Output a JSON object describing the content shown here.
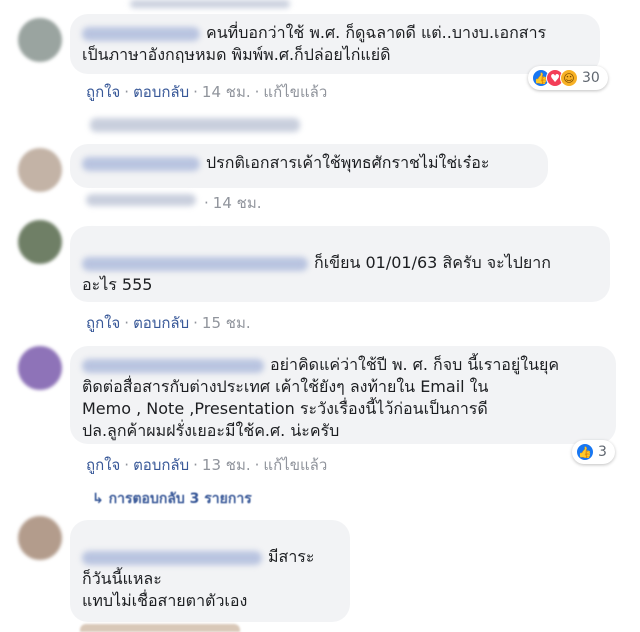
{
  "colors": {
    "link": "#385898",
    "meta": "#90949c",
    "bubble": "#f2f3f5",
    "like": "#1877f2",
    "love": "#f33e58",
    "haha": "#f7b125"
  },
  "comments": [
    {
      "line1": "คนที่บอกว่าใช้ พ.ศ. ก็ดูฉลาดดี แต่..บางบ.เอกสาร",
      "line2": "เป็นภาษาอังกฤษหมด พิมพ์พ.ศ.ก็ปล่อยไก่แย่ดิ",
      "like": "ถูกใจ",
      "reply": "ตอบกลับ",
      "time": "14 ชม.",
      "edited": "แก้ไขแล้ว",
      "reactions": {
        "icons": [
          "like-icon",
          "love-icon",
          "haha-icon"
        ],
        "count": "30"
      }
    },
    {
      "line1": "ปรกติเอกสารเค้าใช้พุทธศักราชไม่ใช่เร๋อะ",
      "time": "14 ชม."
    },
    {
      "line1": "ก็เขียน 01/01/63 สิครับ จะไปยาก",
      "line2": "อะไร 555",
      "like": "ถูกใจ",
      "reply": "ตอบกลับ",
      "time": "15 ชม."
    },
    {
      "line1": "อย่าคิดแค่ว่าใช้ปี พ. ศ. ก็จบ นี้เราอยู่ในยุค",
      "line2": "ติดต่อสื่อสารกับต่างประเทศ เค้าใช้ยังๆ ลงท้ายใน Email ใน",
      "line3": "Memo , Note ,Presentation ระวังเรื่องนี้ไว้ก่อนเป็นการดี",
      "line4": "ปล.ลูกค้าผมฝรั่งเยอะมีใช้ค.ศ. น่ะครับ",
      "like": "ถูกใจ",
      "reply": "ตอบกลับ",
      "time": "13 ชม.",
      "edited": "แก้ไขแล้ว",
      "reactions": {
        "icons": [
          "like-icon"
        ],
        "count": "3"
      },
      "replies": "การตอบกลับ 3 รายการ"
    },
    {
      "line1": "มีสาระ",
      "line2": "ก็วันนี้แหละ",
      "line3": "แทบไม่เชื่อสายตาตัวเอง"
    }
  ]
}
